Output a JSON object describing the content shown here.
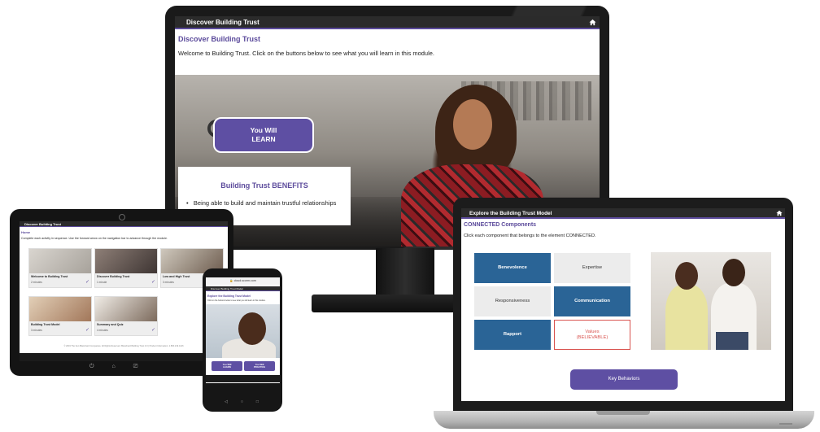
{
  "monitor": {
    "header": "Discover Building Trust",
    "title": "Discover Building Trust",
    "intro": "Welcome to Building Trust. Click on the buttons below to see what you will learn in this module.",
    "learn_button": {
      "line1": "You Will",
      "line2": "LEARN"
    },
    "benefits": {
      "title": "Building Trust BENEFITS",
      "item": "Being able to build and maintain trustful relationships"
    }
  },
  "tablet": {
    "header": "Discover Building Trust",
    "home": "Home",
    "intro": "Complete each activity in sequence. Use the forward arrow on the navigation bar to advance through the module.",
    "cards": [
      {
        "title": "Welcome to Building Trust",
        "meta": "2 minutes"
      },
      {
        "title": "Discover Building Trust",
        "meta": "1 minute"
      },
      {
        "title": "Low and High Trust",
        "meta": "3 minutes"
      },
      {
        "title": "Building Trust Model",
        "meta": "3 minutes"
      },
      {
        "title": "Summary and Quiz",
        "meta": "4 minutes"
      }
    ],
    "footer": "© 2019 The Ken Blanchard Companies. All Rights Reserved. Blanchard Building Trust 3.0 | Product Information: 1.800.219.1126"
  },
  "phone": {
    "url": "cloud.scorm.com",
    "header": "Discover Building Trust Model",
    "title": "Explore the Building Trust Model",
    "intro": "Click on the buttons below to see what you will learn in this module.",
    "learn_button": {
      "line1": "You Will",
      "line2": "LEARN"
    },
    "practice_button": {
      "line1": "You Will",
      "line2": "PRACTICE"
    }
  },
  "laptop": {
    "header": "Explore the Building Trust Model",
    "title": "CONNECTED Components",
    "intro": "Click each component that belongs to the element CONNECTED.",
    "components": [
      {
        "label": "Benevolence",
        "style": "blue"
      },
      {
        "label": "Expertise",
        "style": "gray"
      },
      {
        "label": "Responsiveness",
        "style": "gray"
      },
      {
        "label": "Communication",
        "style": "blue"
      },
      {
        "label": "Rapport",
        "style": "blue"
      },
      {
        "label": "Values",
        "sublabel": "(BELIEVABLE)",
        "style": "red"
      }
    ],
    "key_button": "Key Behaviors"
  },
  "colors": {
    "accent_purple": "#5e4fa3",
    "header_dark": "#2b2b2b",
    "tile_blue": "#2a6496",
    "tile_gray": "#ececec",
    "alert_red": "#d9534f"
  },
  "icons": [
    "home-icon",
    "check-icon",
    "back-arrow-icon",
    "forward-arrow-icon",
    "lock-icon",
    "android-back-icon",
    "android-home-icon",
    "android-recents-icon"
  ]
}
